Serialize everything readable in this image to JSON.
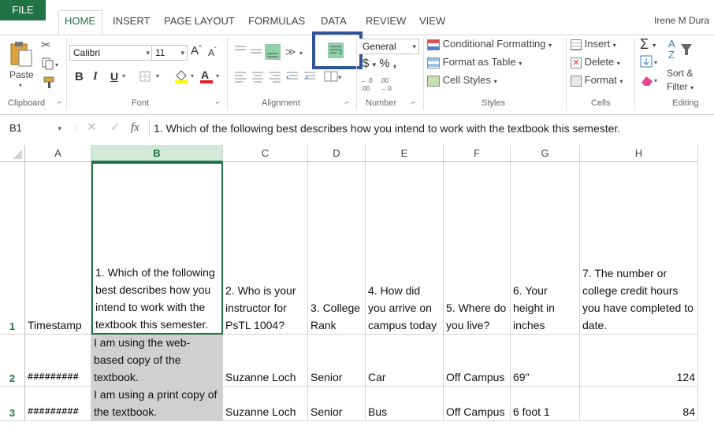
{
  "tabs": [
    "FILE",
    "HOME",
    "INSERT",
    "PAGE LAYOUT",
    "FORMULAS",
    "DATA",
    "REVIEW",
    "VIEW"
  ],
  "user": "Irene M Dura",
  "ribbon": {
    "clipboard": {
      "paste": "Paste",
      "label": "Clipboard"
    },
    "font": {
      "name": "Calibri",
      "size": "11",
      "label": "Font"
    },
    "alignment": {
      "label": "Alignment"
    },
    "number": {
      "format": "General",
      "symbols": "$ - % ,",
      "label": "Number"
    },
    "styles": {
      "conditional": "Conditional Formatting",
      "format_table": "Format as Table",
      "cell_styles": "Cell Styles",
      "label": "Styles"
    },
    "cells": {
      "insert": "Insert",
      "delete": "Delete",
      "format": "Format",
      "label": "Cells"
    },
    "editing": {
      "sort": "Sort &",
      "filter": "Filter",
      "label": "Editing"
    }
  },
  "formula_bar": {
    "name_box": "B1",
    "fx": "fx",
    "content": "1. Which of the following best describes how you intend to work with the textbook this semester."
  },
  "columns": [
    "A",
    "B",
    "C",
    "D",
    "E",
    "F",
    "G",
    "H"
  ],
  "rows": [
    {
      "num": "1",
      "cells": [
        "Timestamp",
        "1. Which of the following best describes how you intend to work with the textbook this semester.",
        "2. Who is your instructor for PsTL 1004?",
        "3. College Rank",
        "4. How did you arrive on campus today",
        "5. Where do you live?",
        "6. Your height in inches",
        "7. The number or college credit hours you have completed to date."
      ]
    },
    {
      "num": "2",
      "cells": [
        "#########",
        "I am using the web-based copy of the textbook.",
        "Suzanne Loch",
        "Senior",
        "Car",
        "Off Campus",
        "69\"",
        "124"
      ]
    },
    {
      "num": "3",
      "cells": [
        "#########",
        "I am using a print copy of  the textbook.",
        "Suzanne Loch",
        "Senior",
        "Bus",
        "Off Campus",
        "6 foot 1",
        "84"
      ]
    }
  ],
  "colors": {
    "accent": "#217346",
    "highlight_box": "#2f5597"
  }
}
